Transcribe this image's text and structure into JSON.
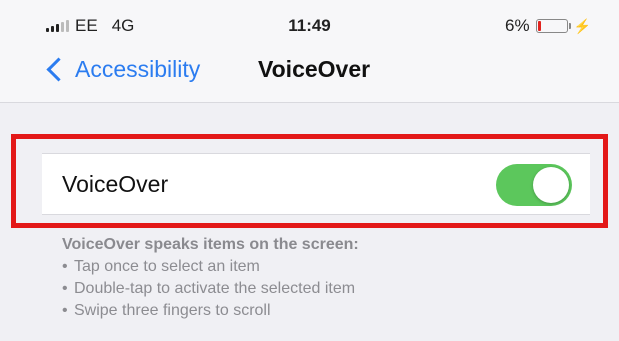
{
  "status_bar": {
    "carrier": "EE",
    "network": "4G",
    "time": "11:49",
    "battery_percent": "6%",
    "battery_level": 0.06,
    "battery_color": "#e1231e"
  },
  "nav": {
    "back_label": "Accessibility",
    "title": "VoiceOver",
    "accent_color": "#2b7cf0"
  },
  "setting": {
    "label": "VoiceOver",
    "toggle_on": true,
    "toggle_color": "#5cc75c"
  },
  "highlight_color": "#e31818",
  "description": {
    "heading": "VoiceOver speaks items on the screen:",
    "items": [
      "Tap once to select an item",
      "Double-tap to activate the selected item",
      "Swipe three fingers to scroll"
    ]
  }
}
